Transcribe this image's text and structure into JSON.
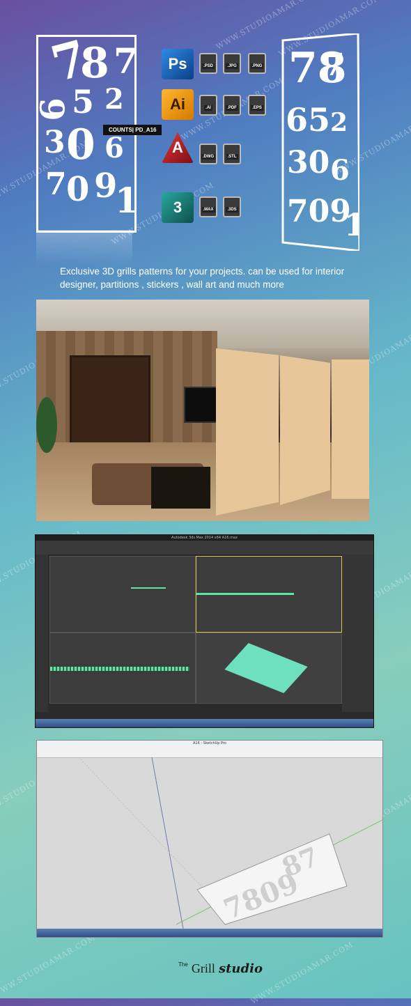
{
  "watermark_text": "WWW.STUDIOAMAR.COM",
  "product_tag": "COUNTS| PD_A16",
  "formats": {
    "ps": {
      "app": "Ps",
      "files": [
        ".PSD",
        ".JPG",
        ".PNG"
      ],
      "color": "#1b6fd1"
    },
    "ai": {
      "app": "Ai",
      "files": [
        ".AI",
        ".PDF",
        ".EPS"
      ],
      "color": "#f29a1f"
    },
    "autocad": {
      "app": "A",
      "files": [
        ".DWG",
        ".STL"
      ],
      "color": "#c8202d"
    },
    "max": {
      "app": "3",
      "files": [
        ".MAX",
        ".3DS"
      ],
      "color": "#1f8c86"
    }
  },
  "tagline": "Exclusive  3D grills patterns for your projects.  can be used for interior designer, partitions , stickers , wall art and much more",
  "max_title": "Autodesk 3ds Max 2014 x64    A16.max",
  "sketchup_title": "A16 - SketchUp Pro",
  "logo": {
    "prefix": "The",
    "main": "Grill",
    "suffix": "studio"
  }
}
